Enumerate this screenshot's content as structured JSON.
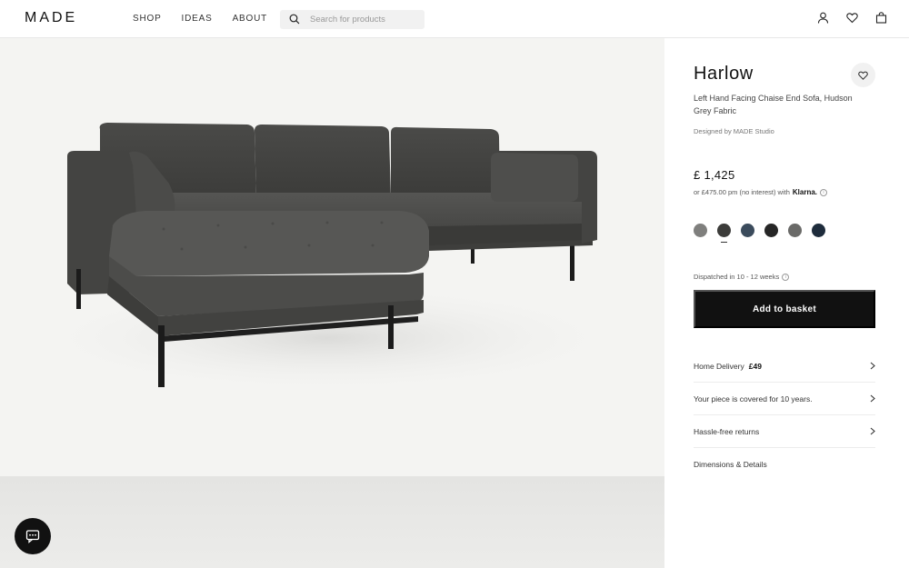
{
  "header": {
    "logo": "MADE",
    "nav": [
      "SHOP",
      "IDEAS",
      "ABOUT"
    ],
    "search_placeholder": "Search for products"
  },
  "product": {
    "title": "Harlow",
    "subtitle": "Left Hand Facing Chaise End Sofa, Hudson Grey Fabric",
    "designer": "Designed by MADE Studio",
    "price": "£ 1,425",
    "finance_prefix": "or £475.00 pm (no interest) with",
    "finance_brand": "Klarna.",
    "dispatch": "Dispatched in 10 - 12 weeks",
    "add_to_basket": "Add to basket",
    "swatches": [
      {
        "name": "light-grey",
        "color": "#7f7f7d"
      },
      {
        "name": "hudson-grey",
        "color": "#3c3c3a",
        "selected": true
      },
      {
        "name": "denim-blue",
        "color": "#3b4b5c"
      },
      {
        "name": "black",
        "color": "#262626"
      },
      {
        "name": "mid-grey",
        "color": "#6a6a68"
      },
      {
        "name": "navy",
        "color": "#1e2c3c"
      }
    ]
  },
  "rows": [
    {
      "label": "Home Delivery",
      "value": "£49"
    },
    {
      "label": "Your piece is covered for 10 years.",
      "value": ""
    },
    {
      "label": "Hassle-free returns",
      "value": ""
    },
    {
      "label": "Dimensions & Details",
      "value": ""
    }
  ],
  "colors": {
    "sofa_fabric": "#4a4a48",
    "button_bg": "#111111",
    "gallery_bg": "#f4f4f2"
  }
}
